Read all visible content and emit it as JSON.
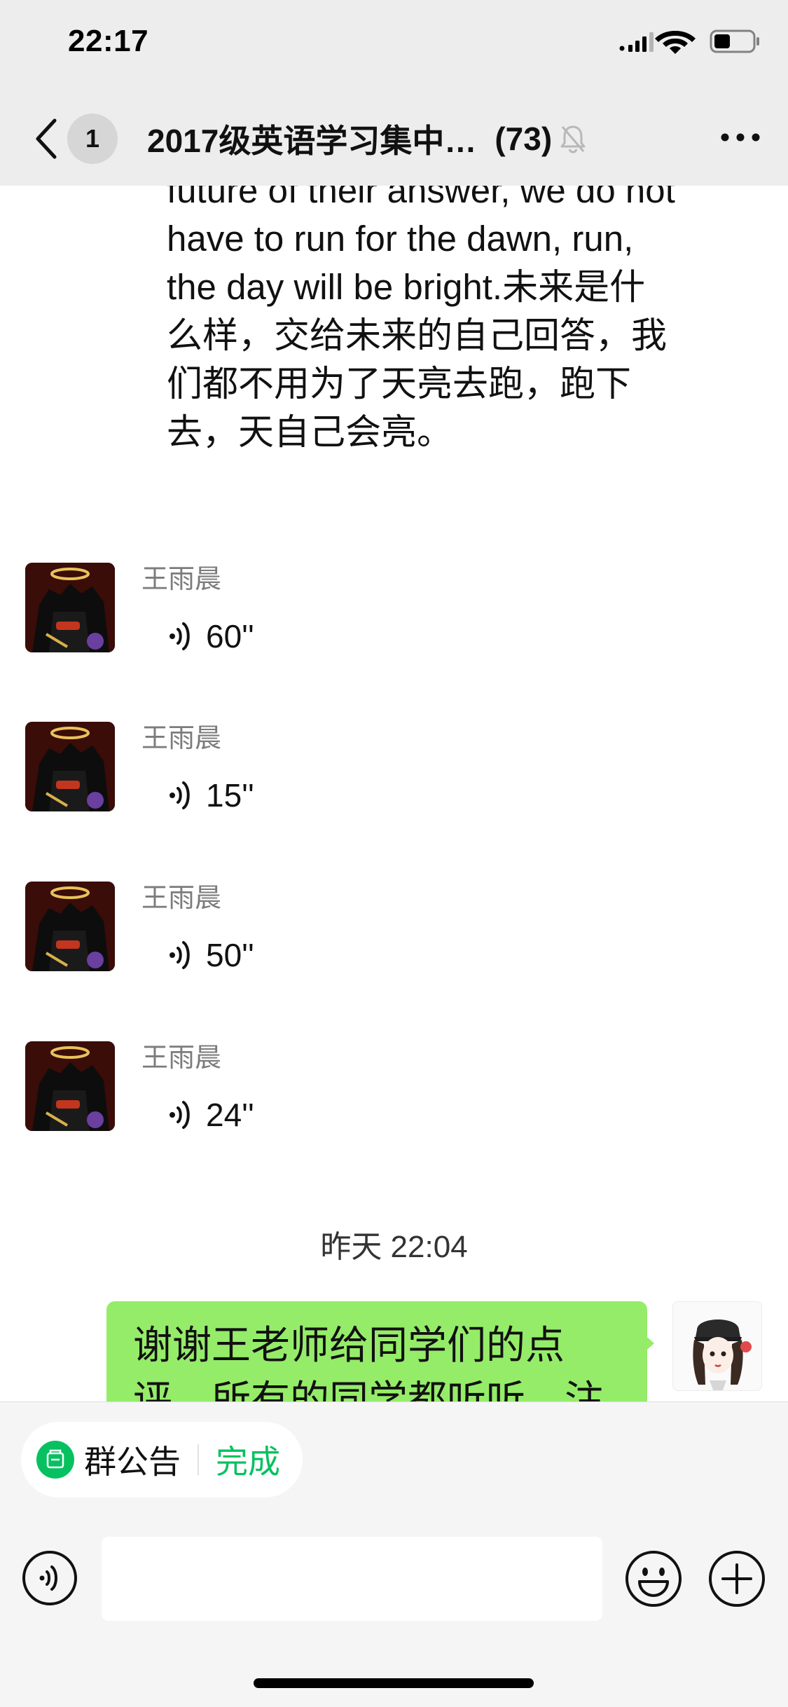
{
  "status_bar": {
    "time": "22:17",
    "icons": [
      "cellular-signal-icon",
      "wifi-icon",
      "battery-icon"
    ]
  },
  "nav": {
    "back_icon": "chevron-left-icon",
    "unread_count": "1",
    "title": "2017级英语学习集中…",
    "member_count": "(73)",
    "mute_icon": "muted-bell-icon",
    "more_icon": "more-dots-icon"
  },
  "messages": {
    "long_text": "future of their answer, we do not have to run for the dawn, run, the day will be bright.未来是什么样，交给未来的自己回答，我们都不用为了天亮去跑，跑下去，天自己会亮。",
    "voice": [
      {
        "sender": "王雨晨",
        "duration": "60''"
      },
      {
        "sender": "王雨晨",
        "duration": "15''"
      },
      {
        "sender": "王雨晨",
        "duration": "50''"
      },
      {
        "sender": "王雨晨",
        "duration": "24''"
      }
    ],
    "timestamp": "昨天 22:04",
    "own_message": "谢谢王老师给同学们的点评，所有的同学都听听，注"
  },
  "bottom": {
    "notice_label": "群公告",
    "notice_done": "完成",
    "input_placeholder": "",
    "voice_toggle_icon": "voice-mode-icon",
    "emoji_icon": "emoji-icon",
    "plus_icon": "plus-icon"
  },
  "colors": {
    "nav_background": "#ededed",
    "bubble_green": "#95ec69",
    "accent_green": "#07c160",
    "sender_gray": "#7c7c7c"
  }
}
